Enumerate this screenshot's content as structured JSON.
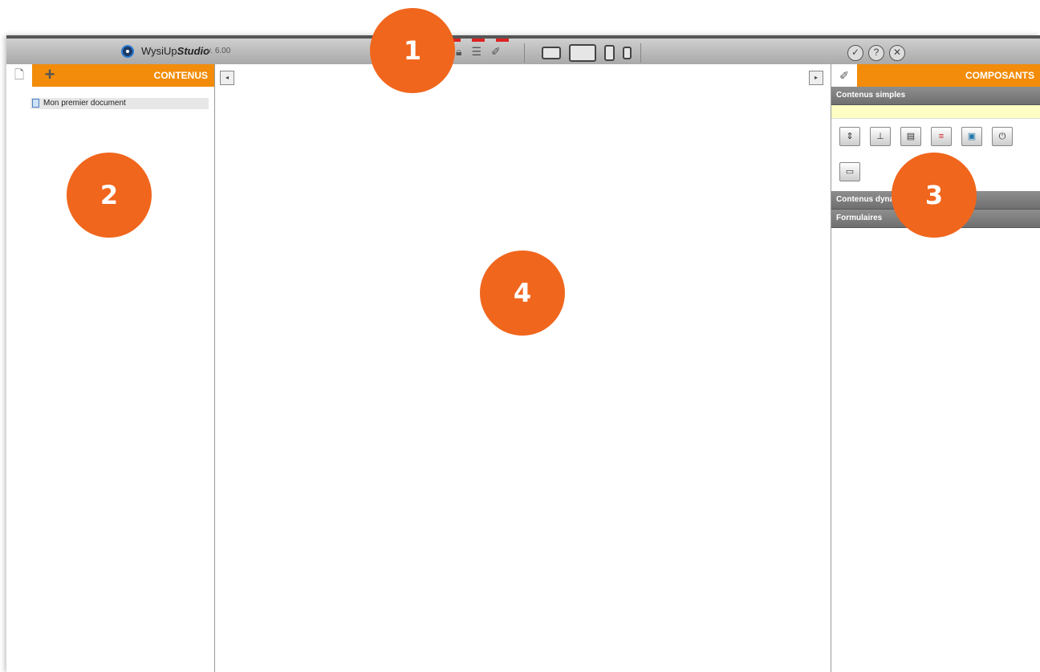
{
  "app": {
    "name_plain": "WysiUp",
    "name_bold": "Studio",
    "version": "v. 6.00"
  },
  "toolbar": {
    "icons": [
      "lock-icon",
      "checklist-icon",
      "tag-icon"
    ],
    "devices": [
      "desktop",
      "tablet-landscape",
      "tablet-portrait",
      "phone"
    ],
    "right_controls": [
      "check-icon",
      "help-icon",
      "close-icon"
    ]
  },
  "left_panel": {
    "title": "CONTENUS",
    "items": [
      {
        "label": "Mon premier document"
      }
    ]
  },
  "right_panel": {
    "title": "COMPOSANTS",
    "sections": [
      {
        "label": "Contenus simples"
      },
      {
        "label": "Contenus dyna"
      },
      {
        "label": "Formulaires"
      }
    ]
  },
  "callouts": [
    "1",
    "2",
    "3",
    "4"
  ],
  "colors": {
    "accent": "#f28c0a",
    "callout": "#f0661d",
    "section_header": "#7a7a7a"
  }
}
